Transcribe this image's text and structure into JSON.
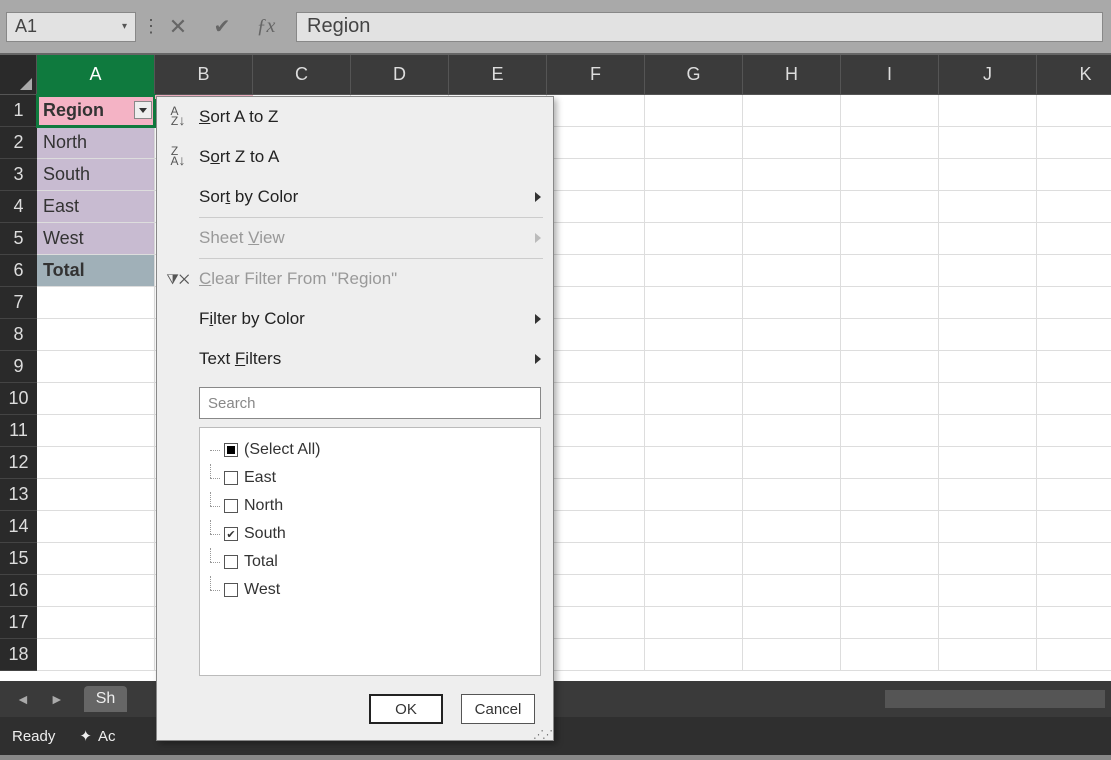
{
  "formula_bar": {
    "name_box": "A1",
    "formula": "Region"
  },
  "columns": [
    "A",
    "B",
    "C",
    "D",
    "E",
    "F",
    "G",
    "H",
    "I",
    "J",
    "K"
  ],
  "active_column_index": 0,
  "rows_visible": 18,
  "cells": {
    "A1": "Region",
    "A2": "North",
    "A3": "South",
    "A4": "East",
    "A5": "West",
    "A6": "Total"
  },
  "active_cell": "A1",
  "filter_menu": {
    "sort_az": "Sort A to Z",
    "sort_za": "Sort Z to A",
    "sort_color": "Sort by Color",
    "sheet_view": "Sheet View",
    "clear_filter": "Clear Filter From \"Region\"",
    "filter_color": "Filter by Color",
    "text_filters": "Text Filters",
    "search_placeholder": "Search",
    "options": [
      {
        "label": "(Select All)",
        "state": "indeterminate"
      },
      {
        "label": "East",
        "state": "unchecked"
      },
      {
        "label": "North",
        "state": "unchecked"
      },
      {
        "label": "South",
        "state": "checked"
      },
      {
        "label": "Total",
        "state": "unchecked"
      },
      {
        "label": "West",
        "state": "unchecked"
      }
    ],
    "ok": "OK",
    "cancel": "Cancel"
  },
  "sheet_bar": {
    "tab_label": "Sh"
  },
  "status_bar": {
    "ready": "Ready",
    "accessibility": "Ac"
  }
}
